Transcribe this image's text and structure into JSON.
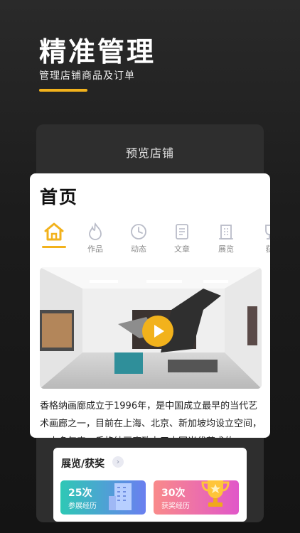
{
  "hero": {
    "title": "精准管理",
    "subtitle": "管理店铺商品及订单"
  },
  "preview": {
    "title": "预览店铺"
  },
  "phone": {
    "title": "首页",
    "tabs": [
      {
        "label": "",
        "icon": "home-icon",
        "active": true
      },
      {
        "label": "作品",
        "icon": "flame-icon"
      },
      {
        "label": "动态",
        "icon": "clock-icon"
      },
      {
        "label": "文章",
        "icon": "document-icon"
      },
      {
        "label": "展览",
        "icon": "building-icon"
      },
      {
        "label": "获",
        "icon": "trophy-icon"
      }
    ],
    "description": "香格纳画廊成立于1996年，是中国成立最早的当代艺术画廊之一，目前在上海、北京、新加坡均设立空间，二十多年来，香格纳画廊致力于中国当代艺术的"
  },
  "awards": {
    "title": "展览/获奖",
    "items": [
      {
        "count": "25次",
        "label": "参展经历"
      },
      {
        "count": "30次",
        "label": "获奖经历"
      }
    ]
  },
  "colors": {
    "accent": "#f2b21c"
  }
}
